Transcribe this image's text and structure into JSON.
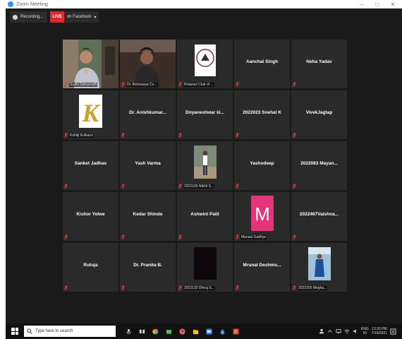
{
  "window": {
    "title": "Zoom Meeting",
    "min": "–",
    "max": "□",
    "close": "✕"
  },
  "topbar": {
    "recording": "Recording...",
    "live_badge": "LIVE",
    "live_platform": "on Facebook",
    "live_chevron": "▾"
  },
  "participants": [
    {
      "name": "",
      "label": "Sudhi Sahasradh",
      "video": "person-video",
      "active": true
    },
    {
      "name": "",
      "label": "Dr. Aishwarya Co...",
      "video": "person-video-2",
      "active": false
    },
    {
      "name": "",
      "label": "Rotaract Club of ...",
      "video": "club-logo",
      "active": false
    },
    {
      "name": "Aanchal Singh",
      "label": "",
      "video": "none",
      "active": false
    },
    {
      "name": "Neha Yadav",
      "label": "",
      "video": "none",
      "active": false
    },
    {
      "name": "",
      "label": "Kshitij Kulkarni",
      "video": "k-logo",
      "active": false
    },
    {
      "name": "Dr. Anishkumar...",
      "label": "",
      "video": "none",
      "active": false
    },
    {
      "name": "Dnyaneshwar ki...",
      "label": "",
      "video": "none",
      "active": false
    },
    {
      "name": "2022023 Snehal K",
      "label": "",
      "video": "none",
      "active": false
    },
    {
      "name": "VivekJagtap",
      "label": "",
      "video": "none",
      "active": false
    },
    {
      "name": "Sanket Jadhav",
      "label": "",
      "video": "none",
      "active": false
    },
    {
      "name": "Yash Varma",
      "label": "",
      "video": "none",
      "active": false
    },
    {
      "name": "",
      "label": "2022100 Nikhil S...",
      "video": "standing-photo",
      "active": false
    },
    {
      "name": "Yashodeep",
      "label": "",
      "video": "none",
      "active": false
    },
    {
      "name": "2022083 Mayan...",
      "label": "",
      "video": "none",
      "active": false
    },
    {
      "name": "Kishor Yelwe",
      "label": "",
      "video": "none",
      "active": false
    },
    {
      "name": "Kedar Shinde",
      "label": "",
      "video": "none",
      "active": false
    },
    {
      "name": "Ashwini Patil",
      "label": "",
      "video": "none",
      "active": false
    },
    {
      "name": "",
      "label": "Manasi Gadhye",
      "video": "m-avatar",
      "active": false
    },
    {
      "name": "2022467Vaishna...",
      "label": "",
      "video": "none",
      "active": false
    },
    {
      "name": "Rutuja",
      "label": "",
      "video": "none",
      "active": false
    },
    {
      "name": "Dr. Pranita B.",
      "label": "",
      "video": "none",
      "active": false
    },
    {
      "name": "",
      "label": "2022133 Dhiraj S...",
      "video": "dark-video",
      "active": false
    },
    {
      "name": "Mrunal  Deshmu...",
      "label": "",
      "video": "none",
      "active": false
    },
    {
      "name": "",
      "label": "2022165 Megha...",
      "video": "woman-photo",
      "active": false
    }
  ],
  "taskbar": {
    "search_placeholder": "Type here to search",
    "lang_top": "ENG",
    "lang_bottom": "IN",
    "time": "12:33 PM",
    "date": "7/19/2021"
  },
  "icons": {
    "mic": "mic-muted-icon",
    "zoom_logo": "zoom-logo-icon",
    "recording": "recording-icon",
    "windows": "windows-start-icon",
    "search": "search-icon"
  },
  "colors": {
    "active_border": "#c2d600",
    "live_red": "#e02828",
    "mic_muted": "#e03c3c",
    "m_avatar": "#e4347a"
  }
}
